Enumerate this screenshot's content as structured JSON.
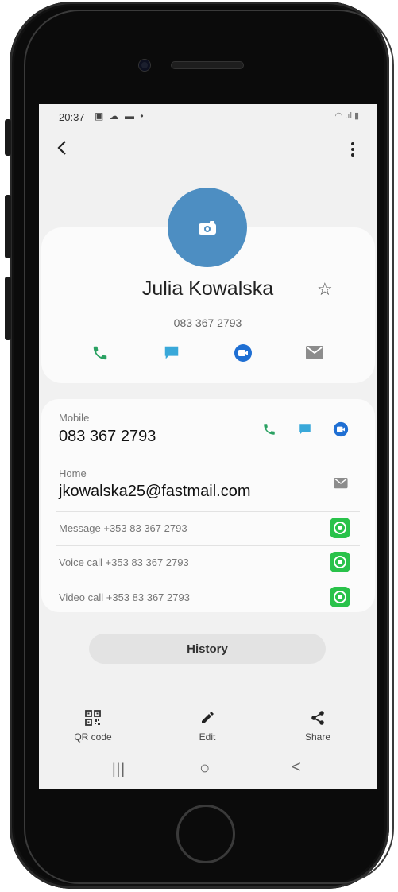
{
  "status_bar": {
    "time": "20:37",
    "left_icons": "▣ ☁ ▬ •",
    "right_icons": "◠ .ıl ▮"
  },
  "contact": {
    "name": "Julia Kowalska",
    "number_summary": "083 367 2793"
  },
  "details": {
    "mobile_label": "Mobile",
    "mobile_value": "083 367 2793",
    "home_label": "Home",
    "home_value": "jkowalska25@fastmail.com",
    "whatsapp_rows": [
      {
        "text": "Message +353 83 367 2793"
      },
      {
        "text": "Voice call +353 83 367 2793"
      },
      {
        "text": "Video call +353 83 367 2793"
      }
    ]
  },
  "history_label": "History",
  "bottom_bar": {
    "qr_label": "QR code",
    "edit_label": "Edit",
    "share_label": "Share"
  },
  "nav": {
    "recents": "|||",
    "home": "○",
    "back": "<"
  },
  "colors": {
    "avatar": "#4d8ec2",
    "call_green": "#2aa162",
    "message_blue": "#39a8d9",
    "video_blue": "#1f6fd3",
    "whatsapp": "#29c24a"
  },
  "icons": [
    "back-arrow-icon",
    "more-options-icon",
    "camera-icon",
    "star-icon",
    "call-icon",
    "message-icon",
    "video-icon",
    "email-icon",
    "whatsapp-icon",
    "qr-code-icon",
    "edit-icon",
    "share-icon",
    "recents-icon",
    "home-icon",
    "nav-back-icon"
  ]
}
